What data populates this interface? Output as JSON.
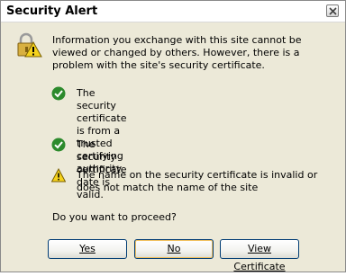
{
  "window": {
    "title": "Security Alert"
  },
  "intro": "Information you exchange with this site cannot be viewed or changed by others. However, there is a problem with the site's security certificate.",
  "checks": [
    {
      "status": "ok",
      "icon": "green-check-icon",
      "text": "The security certificate is from a trusted certifying authority."
    },
    {
      "status": "ok",
      "icon": "green-check-icon",
      "text": "The security certificate date is valid."
    },
    {
      "status": "warning",
      "icon": "warning-triangle-icon",
      "text": "The name on the security certificate is invalid or does not match the name of the site"
    }
  ],
  "prompt": "Do you want to proceed?",
  "buttons": {
    "yes": "Yes",
    "no": "No",
    "view": "View Certificate"
  },
  "colors": {
    "check": "#2c8a2c",
    "warning": "#f5d21c"
  }
}
